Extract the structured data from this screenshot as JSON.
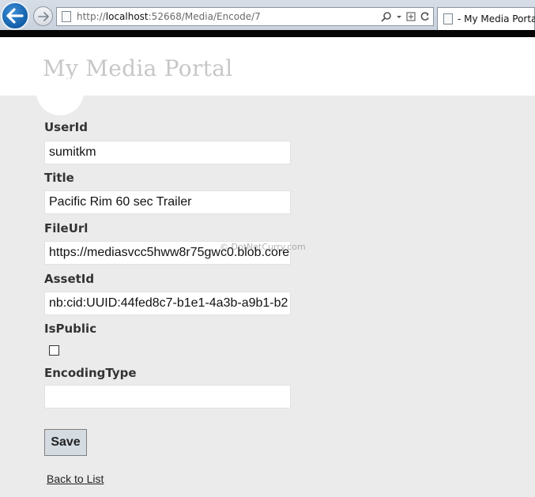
{
  "browser": {
    "url_prefix": "http://",
    "url_host": "localhost",
    "url_path": ":52668/Media/Encode/7",
    "tab_title": "- My Media Portal",
    "icons": [
      "back-arrow-icon",
      "forward-arrow-icon",
      "page-icon",
      "search-icon",
      "dropdown-icon",
      "compatibility-icon",
      "refresh-icon"
    ]
  },
  "site": {
    "title": "My Media Portal"
  },
  "form": {
    "fields": [
      {
        "label": "UserId",
        "value": "sumitkm"
      },
      {
        "label": "Title",
        "value": "Pacific Rim 60 sec Trailer"
      },
      {
        "label": "FileUrl",
        "value": "https://mediasvcc5hww8r75gwc0.blob.core"
      },
      {
        "label": "AssetId",
        "value": "nb:cid:UUID:44fed8c7-b1e1-4a3b-a9b1-b2"
      },
      {
        "label": "IsPublic",
        "checked": false
      },
      {
        "label": "EncodingType",
        "value": ""
      }
    ],
    "save_label": "Save",
    "back_link_label": "Back to List"
  },
  "watermark": "© DotNetCurry.com",
  "colors": {
    "back_button": "#125ea8",
    "page_background": "#ebebeb",
    "title_color": "#c7c7c7"
  }
}
